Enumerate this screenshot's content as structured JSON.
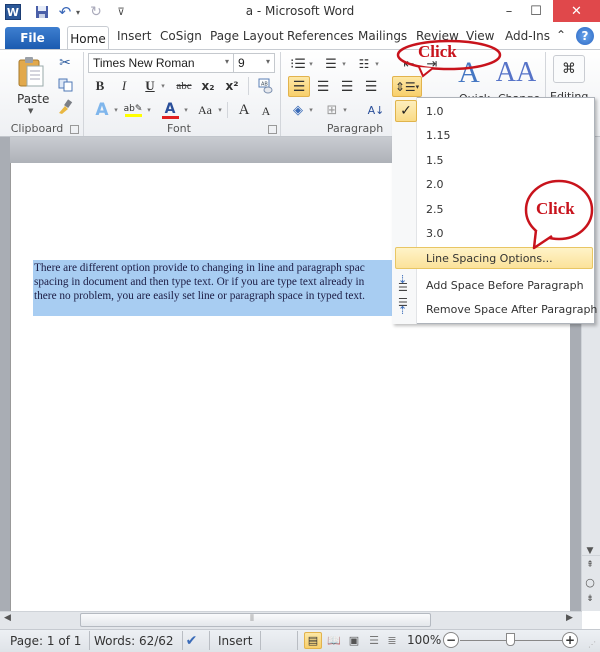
{
  "window": {
    "title": "a  -  Microsoft Word",
    "minimize_glyph": "–",
    "maximize_glyph": "☐",
    "close_glyph": "✕"
  },
  "quick_access": {
    "app_icon": "W",
    "save_icon": "save-icon",
    "undo_icon": "undo-icon",
    "redo_icon": "redo-icon",
    "customize_glyph": "⊽"
  },
  "tabs": {
    "file": "File",
    "items": [
      "Home",
      "Insert",
      "CoSign",
      "Page Layout",
      "References",
      "Mailings",
      "Review",
      "View",
      "Add-Ins"
    ],
    "active": "Home",
    "help_glyph": "?"
  },
  "ribbon": {
    "clipboard": {
      "label": "Clipboard",
      "paste": "Paste"
    },
    "font": {
      "label": "Font",
      "font_name": "Times New Roman",
      "font_size": "9",
      "bold": "B",
      "italic": "I",
      "underline": "U",
      "strikethrough": "abc",
      "subscript": "x₂",
      "superscript": "x²",
      "change_case": "Aa",
      "grow": "A",
      "shrink": "A",
      "highlight_color": "#ffff00",
      "font_color": "#e02020"
    },
    "paragraph": {
      "label": "Paragraph"
    },
    "styles": {
      "quick": "Quick",
      "change": "Change"
    },
    "editing": {
      "label": "Editing"
    }
  },
  "document": {
    "lines": [
      "There are different option provide to changing in line and paragraph spac",
      "spacing in document and then type text. Or if you are type text already  in",
      "there no problem, you are easily set line or paragraph space in typed text."
    ]
  },
  "line_spacing_menu": {
    "selected": "1.0",
    "options": [
      "1.0",
      "1.15",
      "1.5",
      "2.0",
      "2.5",
      "3.0"
    ],
    "line_spacing_options": "Line Spacing Options...",
    "add_space_before": "Add Space Before Paragraph",
    "remove_space_after": "Remove Space After Paragraph"
  },
  "annotations": {
    "callout_top": "Click",
    "callout_menu": "Click",
    "color": "#c8131c"
  },
  "status_bar": {
    "page": "Page: 1 of 1",
    "words": "Words: 62/62",
    "mode": "Insert",
    "zoom": "100%",
    "zoom_level_percent": 100
  }
}
